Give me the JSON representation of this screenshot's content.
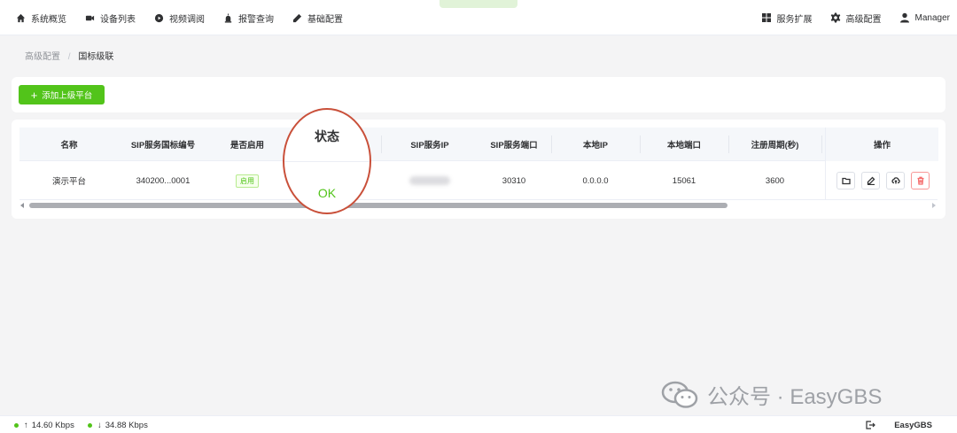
{
  "nav": {
    "items": [
      {
        "label": "系统概览",
        "icon": "home-icon"
      },
      {
        "label": "设备列表",
        "icon": "video-camera-icon"
      },
      {
        "label": "视频调阅",
        "icon": "play-circle-icon"
      },
      {
        "label": "报警查询",
        "icon": "alarm-icon"
      },
      {
        "label": "基础配置",
        "icon": "edit-icon"
      }
    ],
    "right": [
      {
        "label": "服务扩展",
        "icon": "grid-icon"
      },
      {
        "label": "高级配置",
        "icon": "gear-icon"
      },
      {
        "label": "Manager",
        "icon": "user-icon"
      }
    ]
  },
  "breadcrumb": {
    "parent": "高级配置",
    "separator": "/",
    "current": "国标级联"
  },
  "toolbar": {
    "add_label": "添加上级平台",
    "add_icon": "plus-icon"
  },
  "table": {
    "columns": [
      "名称",
      "SIP服务国标编号",
      "是否启用",
      "SIP服务IP",
      "SIP服务端口",
      "本地IP",
      "本地端口",
      "注册周期(秒)",
      "操作"
    ],
    "rows": [
      {
        "name": "演示平台",
        "sip_id": "340200...0001",
        "enabled": "启用",
        "sip_ip": "",
        "sip_port": "30310",
        "local_ip": "0.0.0.0",
        "local_port": "15061",
        "register_period": "3600"
      }
    ],
    "actions": [
      "folder-icon",
      "edit-icon",
      "upload-cloud-icon",
      "delete-icon"
    ]
  },
  "callout": {
    "title": "状态",
    "value": "OK"
  },
  "watermark": {
    "text": "公众号 · EasyGBS",
    "icon": "wechat-icon"
  },
  "footer": {
    "upload": "14.60 Kbps",
    "download": "34.88 Kbps",
    "brand": "EasyGBS",
    "icon": "logout-icon"
  },
  "colors": {
    "accent": "#52c41a",
    "callout_border": "#c9503a",
    "danger": "#f56c6c"
  }
}
